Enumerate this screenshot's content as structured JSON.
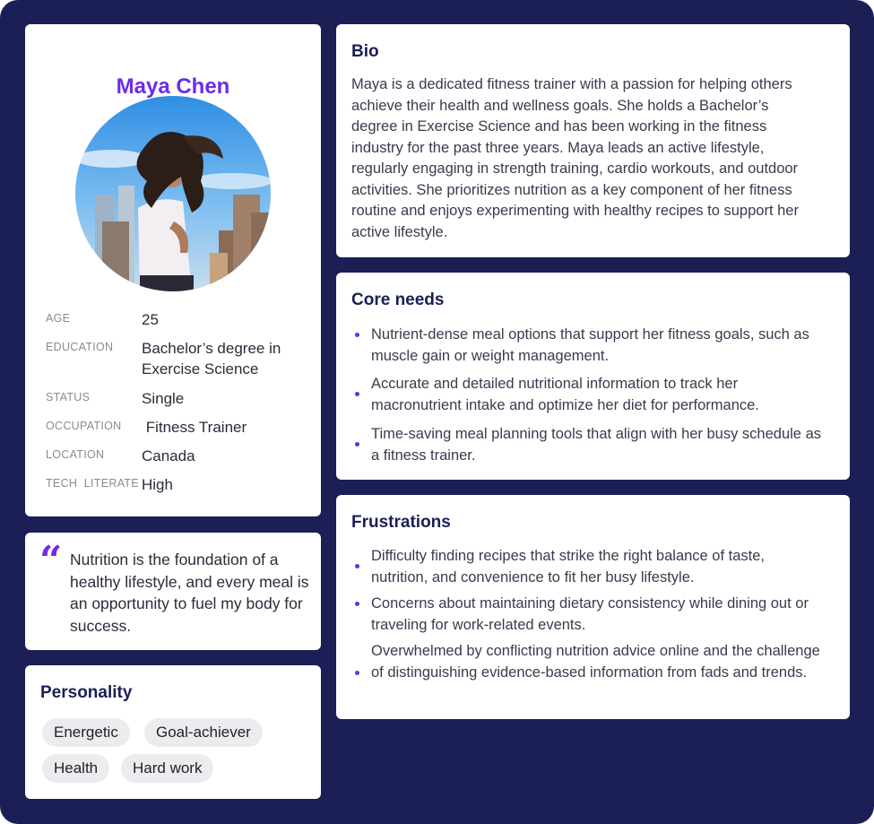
{
  "profile": {
    "name": "Maya Chen",
    "attributes": [
      {
        "key": "AGE",
        "value": "25"
      },
      {
        "key": "EDUCATION",
        "value": "Bachelor’s degree in Exercise Science"
      },
      {
        "key": "STATUS",
        "value": "Single"
      },
      {
        "key": "OCCUPATION",
        "value": " Fitness Trainer"
      },
      {
        "key": "LOCATION",
        "value": "Canada"
      },
      {
        "key": "TECH  LITERATE",
        "value": "High"
      }
    ]
  },
  "quote": {
    "text": "Nutrition is the foundation of a healthy lifestyle, and every meal is an opportunity to fuel my body for success."
  },
  "personality": {
    "title": "Personality",
    "tags": [
      "Energetic",
      "Goal-achiever",
      "Health",
      "Hard work"
    ]
  },
  "bio": {
    "title": "Bio",
    "text": "Maya is a dedicated fitness trainer with a passion for helping others achieve their health and wellness goals. She holds a Bachelor’s degree in Exercise Science and has been working in the fitness industry for the past three years. Maya leads an active lifestyle, regularly engaging in strength training, cardio workouts, and outdoor activities. She prioritizes nutrition as a key component of her fitness routine and enjoys experimenting with healthy recipes to support her active lifestyle."
  },
  "core_needs": {
    "title": "Core needs",
    "items": [
      "Nutrient-dense meal options that support her fitness goals, such as muscle gain or weight management.",
      "Accurate and detailed nutritional information to track her macronutrient intake and optimize her diet for performance.",
      "Time-saving meal planning tools that align with her busy schedule as a fitness trainer."
    ]
  },
  "frustrations": {
    "title": "Frustrations",
    "items": [
      "Difficulty finding recipes that strike the right balance of taste, nutrition, and convenience to fit her busy lifestyle.",
      "Concerns about maintaining dietary consistency while dining out or traveling for work-related events.",
      "Overwhelmed by conflicting nutrition advice online and the challenge of distinguishing evidence-based information from fads and trends."
    ]
  },
  "colors": {
    "background": "#1b1f56",
    "accent": "#6c2ce8",
    "card": "#ffffff",
    "tag": "#ececee"
  }
}
